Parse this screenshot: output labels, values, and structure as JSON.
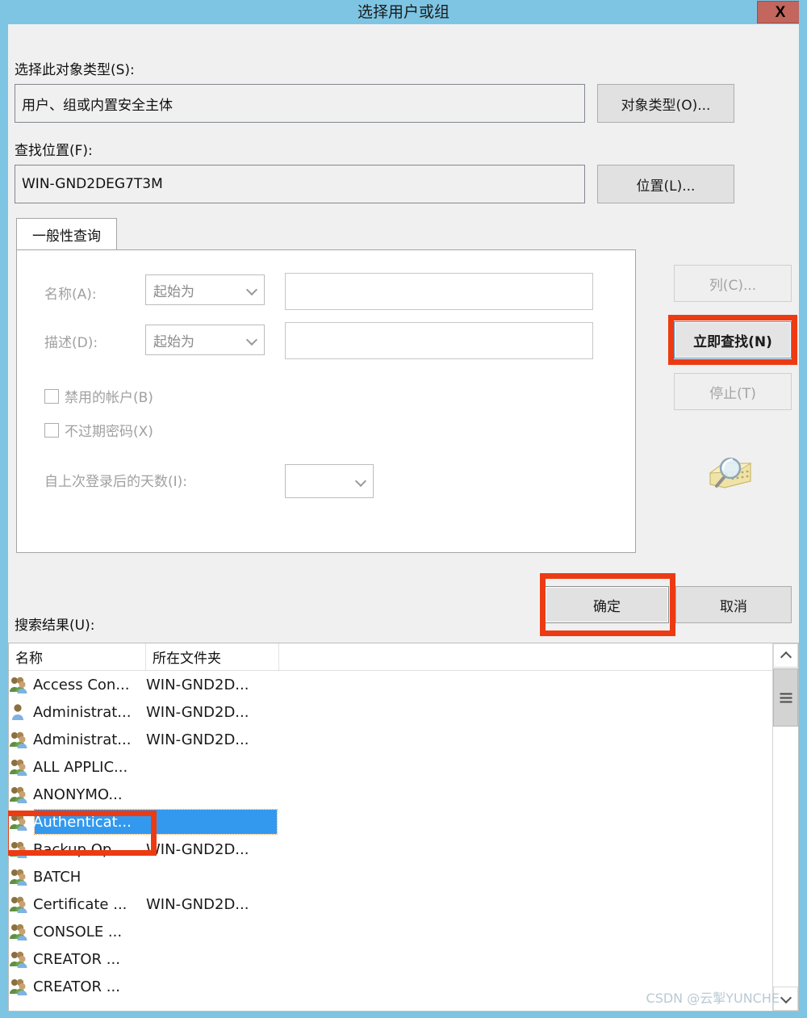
{
  "window": {
    "title": "选择用户或组",
    "close_label": "X",
    "titlebar_color": "#7ec5e4",
    "close_color": "#c2665e"
  },
  "object_type": {
    "label": "选择此对象类型(S):",
    "value": "用户、组或内置安全主体",
    "button": "对象类型(O)..."
  },
  "location": {
    "label": "查找位置(F):",
    "value": "WIN-GND2DEG7T3M",
    "button": "位置(L)..."
  },
  "query_tab": {
    "label": "一般性查询"
  },
  "query": {
    "name_label": "名称(A):",
    "name_condition": "起始为",
    "name_value": "",
    "desc_label": "描述(D):",
    "desc_condition": "起始为",
    "desc_value": "",
    "disabled_accounts": "禁用的帐户(B)",
    "non_expiring_password": "不过期密码(X)",
    "days_since_logon_label": "自上次登录后的天数(I):",
    "days_since_logon_value": ""
  },
  "side_buttons": {
    "columns": "列(C)...",
    "find_now": "立即查找(N)",
    "stop": "停止(T)"
  },
  "dialog_buttons": {
    "ok": "确定",
    "cancel": "取消"
  },
  "results": {
    "label": "搜索结果(U):",
    "columns": [
      "名称",
      "所在文件夹",
      ""
    ],
    "rows": [
      {
        "icon": "group-icon",
        "name": "Access Con...",
        "folder": "WIN-GND2D...",
        "selected": false
      },
      {
        "icon": "user-icon",
        "name": "Administrat...",
        "folder": "WIN-GND2D...",
        "selected": false
      },
      {
        "icon": "group-icon",
        "name": "Administrat...",
        "folder": "WIN-GND2D...",
        "selected": false
      },
      {
        "icon": "group-icon",
        "name": "ALL APPLIC...",
        "folder": "",
        "selected": false
      },
      {
        "icon": "group-icon",
        "name": "ANONYMO...",
        "folder": "",
        "selected": false
      },
      {
        "icon": "group-icon",
        "name": "Authenticat...",
        "folder": "",
        "selected": true
      },
      {
        "icon": "group-icon",
        "name": "Backup Op...",
        "folder": "WIN-GND2D...",
        "selected": false
      },
      {
        "icon": "group-icon",
        "name": "BATCH",
        "folder": "",
        "selected": false
      },
      {
        "icon": "group-icon",
        "name": "Certificate ...",
        "folder": "WIN-GND2D...",
        "selected": false
      },
      {
        "icon": "group-icon",
        "name": "CONSOLE ...",
        "folder": "",
        "selected": false
      },
      {
        "icon": "group-icon",
        "name": "CREATOR ...",
        "folder": "",
        "selected": false
      },
      {
        "icon": "group-icon",
        "name": "CREATOR ...",
        "folder": "",
        "selected": false
      }
    ]
  },
  "annotations": {
    "highlight_color": "#ec3b13",
    "selection_color": "#3399ef"
  },
  "watermark": "CSDN @云掣YUNCHE"
}
